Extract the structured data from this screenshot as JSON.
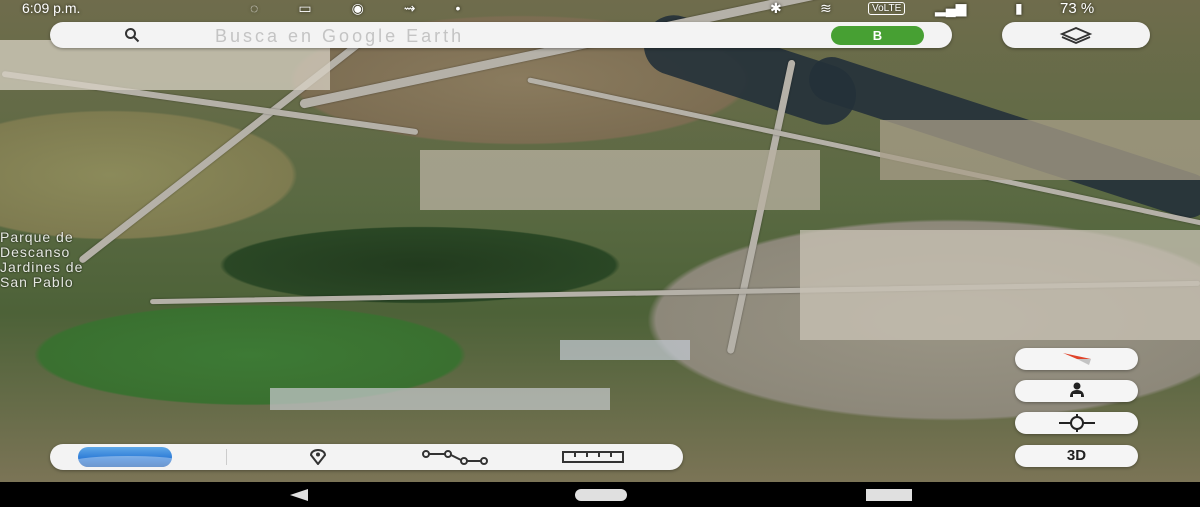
{
  "status_bar": {
    "time": "6:09 p.m.",
    "network_badge": "VoLTE",
    "battery": "73 %"
  },
  "search": {
    "placeholder": "Busca en Google Earth",
    "avatar_letter": "B"
  },
  "map": {
    "place_label_lines": [
      "Parque de",
      "Descanso",
      "Jardines de",
      "San Pablo"
    ]
  },
  "controls": {
    "three_d_label": "3D"
  },
  "colors": {
    "avatar_green": "#47a033",
    "compass_red": "#e0442b",
    "panel_bg": "#f3f3f3"
  },
  "icons": {
    "search": "search-icon",
    "layers": "layers-icon",
    "compass": "compass-icon",
    "pegman": "pegman-icon",
    "my_location": "my-location-icon",
    "place_marker": "place-marker-icon",
    "path": "path-icon",
    "ruler": "ruler-icon"
  }
}
